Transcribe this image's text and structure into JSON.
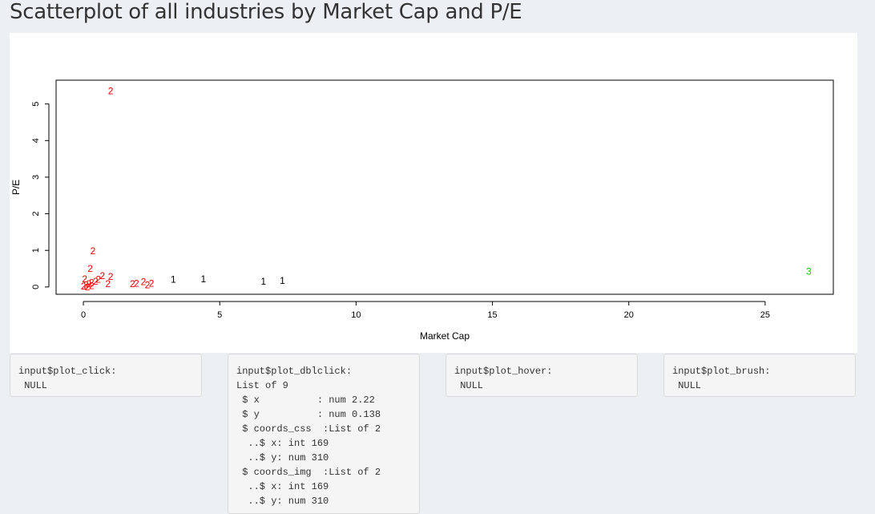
{
  "page": {
    "title": "Scatterplot of all industries by Market Cap and P/E"
  },
  "chart_data": {
    "type": "scatter",
    "xlabel": "Market Cap",
    "ylabel": "P/E",
    "xlim": [
      -1,
      27.5
    ],
    "ylim": [
      -0.2,
      5.65
    ],
    "x_ticks": [
      0,
      5,
      10,
      15,
      20,
      25
    ],
    "y_ticks": [
      0,
      1,
      2,
      3,
      4,
      5
    ],
    "grid": false,
    "legend": "none",
    "series": [
      {
        "marker": "2",
        "color": "#ff0000",
        "points": [
          {
            "x": 1.0,
            "y": 5.35
          },
          {
            "x": 0.35,
            "y": 0.98
          },
          {
            "x": 0.25,
            "y": 0.5
          },
          {
            "x": 0.7,
            "y": 0.3
          },
          {
            "x": 1.0,
            "y": 0.28
          },
          {
            "x": 0.05,
            "y": 0.22
          },
          {
            "x": 0.55,
            "y": 0.2
          },
          {
            "x": 0.45,
            "y": 0.15
          },
          {
            "x": 0.3,
            "y": 0.12
          },
          {
            "x": 0.2,
            "y": 0.08
          },
          {
            "x": 0.1,
            "y": 0.05
          },
          {
            "x": 0.0,
            "y": 0.02
          },
          {
            "x": 0.15,
            "y": 0.0
          },
          {
            "x": 0.3,
            "y": 0.03
          },
          {
            "x": 0.9,
            "y": 0.08
          },
          {
            "x": 2.2,
            "y": 0.14
          },
          {
            "x": 1.95,
            "y": 0.1
          },
          {
            "x": 2.35,
            "y": 0.05
          },
          {
            "x": 2.5,
            "y": 0.1
          },
          {
            "x": 1.8,
            "y": 0.08
          }
        ]
      },
      {
        "marker": "1",
        "color": "#000000",
        "points": [
          {
            "x": 3.3,
            "y": 0.2
          },
          {
            "x": 4.4,
            "y": 0.22
          },
          {
            "x": 6.6,
            "y": 0.15
          },
          {
            "x": 7.3,
            "y": 0.17
          }
        ]
      },
      {
        "marker": "3",
        "color": "#00cd00",
        "points": [
          {
            "x": 26.6,
            "y": 0.42
          }
        ]
      }
    ]
  },
  "outputs": [
    {
      "label": "input$plot_click:",
      "lines": [
        " NULL"
      ]
    },
    {
      "label": "input$plot_dblclick:",
      "lines": [
        "List of 9",
        " $ x          : num 2.22",
        " $ y          : num 0.138",
        " $ coords_css  :List of 2",
        "  ..$ x: int 169",
        "  ..$ y: num 310",
        " $ coords_img  :List of 2",
        "  ..$ x: int 169",
        "  ..$ y: num 310"
      ]
    },
    {
      "label": "input$plot_hover:",
      "lines": [
        " NULL"
      ]
    },
    {
      "label": "input$plot_brush:",
      "lines": [
        " NULL"
      ]
    }
  ]
}
